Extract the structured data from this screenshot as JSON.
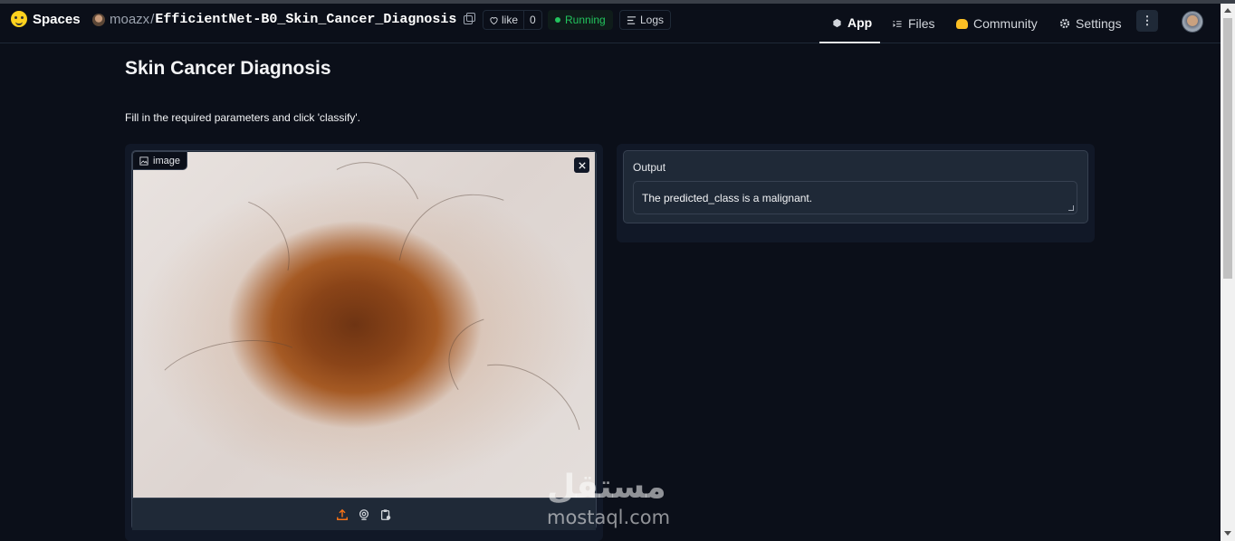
{
  "header": {
    "logo_text": "Spaces",
    "owner": "moazx",
    "separator": "/",
    "repo": "EfficientNet-B0_Skin_Cancer_Diagnosis",
    "like_label": "like",
    "like_count": "0",
    "status": "Running",
    "logs_label": "Logs",
    "nav": [
      {
        "label": "App",
        "icon": "cube-icon"
      },
      {
        "label": "Files",
        "icon": "files-icon"
      },
      {
        "label": "Community",
        "icon": "community-icon"
      },
      {
        "label": "Settings",
        "icon": "gear-icon"
      }
    ],
    "menu_glyph": "⋮"
  },
  "main": {
    "title": "Skin Cancer Diagnosis",
    "description": "Fill in the required parameters and click 'classify'.",
    "image_label": "image",
    "output_label": "Output",
    "output_text": "The predicted_class is a malignant."
  },
  "watermark": {
    "arabic": "مستقل",
    "latin": "mostaql.com"
  },
  "colors": {
    "accent_running": "#22c55e",
    "upload_icon": "#f97316",
    "background": "#0b0f19"
  }
}
